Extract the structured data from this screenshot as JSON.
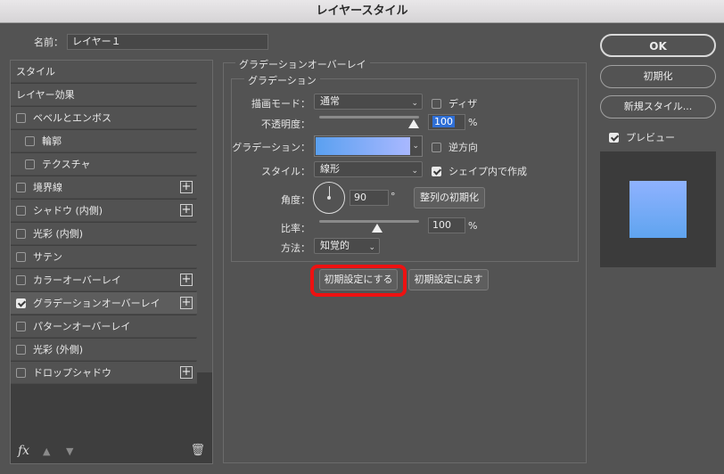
{
  "window": {
    "title": "レイヤースタイル"
  },
  "name_field": {
    "label": "名前：",
    "value": "レイヤー１"
  },
  "left_panel": {
    "items": [
      {
        "label": "スタイル",
        "checkbox": false,
        "checked": false,
        "plus": false
      },
      {
        "label": "レイヤー効果",
        "checkbox": false,
        "checked": false,
        "plus": false
      },
      {
        "label": "ベベルとエンボス",
        "checkbox": true,
        "checked": false,
        "plus": false
      },
      {
        "label": "輪郭",
        "checkbox": true,
        "checked": false,
        "plus": false,
        "indent": true
      },
      {
        "label": "テクスチャ",
        "checkbox": true,
        "checked": false,
        "plus": false,
        "indent": true
      },
      {
        "label": "境界線",
        "checkbox": true,
        "checked": false,
        "plus": true
      },
      {
        "label": "シャドウ (内側)",
        "checkbox": true,
        "checked": false,
        "plus": true
      },
      {
        "label": "光彩 (内側)",
        "checkbox": true,
        "checked": false,
        "plus": false
      },
      {
        "label": "サテン",
        "checkbox": true,
        "checked": false,
        "plus": false
      },
      {
        "label": "カラーオーバーレイ",
        "checkbox": true,
        "checked": false,
        "plus": true
      },
      {
        "label": "グラデーションオーバーレイ",
        "checkbox": true,
        "checked": true,
        "plus": true,
        "active": true
      },
      {
        "label": "パターンオーバーレイ",
        "checkbox": true,
        "checked": false,
        "plus": false
      },
      {
        "label": "光彩 (外側)",
        "checkbox": true,
        "checked": false,
        "plus": false
      },
      {
        "label": "ドロップシャドウ",
        "checkbox": true,
        "checked": false,
        "plus": true
      }
    ],
    "footer": {
      "fx": "fx",
      "up_icon": "arrow-up-icon",
      "down_icon": "arrow-down-icon",
      "trash_icon": "trash-icon"
    }
  },
  "section": {
    "title": "グラデーションオーバーレイ",
    "group_title": "グラデーション"
  },
  "fields": {
    "blend_mode": {
      "label": "描画モード：",
      "value": "通常"
    },
    "dither": {
      "label": "ディザ",
      "checked": false
    },
    "opacity": {
      "label": "不透明度：",
      "value": "100",
      "unit": "%",
      "slider_fraction": 1.0
    },
    "gradient": {
      "label": "グラデーション：",
      "colors": [
        "#5aa0f0",
        "#a9b8ff"
      ]
    },
    "reverse": {
      "label": "逆方向",
      "checked": false
    },
    "style": {
      "label": "スタイル：",
      "value": "線形"
    },
    "align_with_layer": {
      "label": "シェイプ内で作成",
      "checked": true
    },
    "angle": {
      "label": "角度：",
      "value": "90",
      "unit": "°"
    },
    "reset_alignment": {
      "label": "整列の初期化"
    },
    "scale": {
      "label": "比率：",
      "value": "100",
      "unit": "%",
      "slider_fraction": 0.5
    },
    "method": {
      "label": "方法：",
      "value": "知覚的"
    }
  },
  "buttons": {
    "make_default": "初期設定にする",
    "reset_default": "初期設定に戻す",
    "ok": "OK",
    "cancel": "初期化",
    "new_style": "新規スタイル...",
    "preview": {
      "label": "プレビュー",
      "checked": true
    }
  },
  "colors": {
    "highlight_ring": "#ee1111",
    "selection": "#2f6fd6"
  }
}
